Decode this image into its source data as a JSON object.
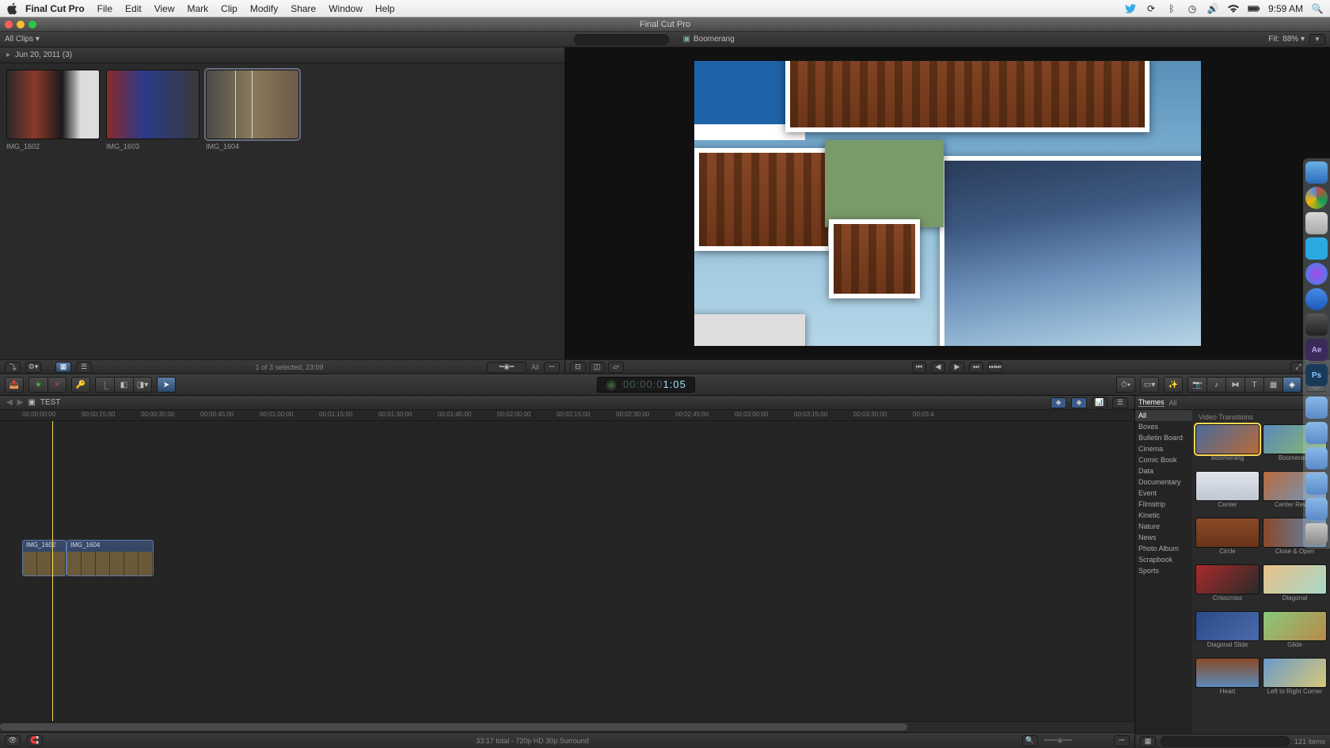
{
  "menubar": {
    "app_name": "Final Cut Pro",
    "menus": [
      "File",
      "Edit",
      "View",
      "Mark",
      "Clip",
      "Modify",
      "Share",
      "Window",
      "Help"
    ],
    "clock": "9:59 AM"
  },
  "window": {
    "title": "Final Cut Pro"
  },
  "browser": {
    "filter_label": "All Clips",
    "event_header": "Jun 20, 2011  (3)",
    "clips": [
      {
        "name": "IMG_1602"
      },
      {
        "name": "IMG_1603"
      },
      {
        "name": "IMG_1604"
      }
    ],
    "footer_status": "1 of 3 selected, 23:09",
    "footer_audio_label": "All"
  },
  "viewer": {
    "title": "Boomerang",
    "fit_label": "Fit:",
    "fit_value": "88%"
  },
  "toolbar": {
    "timecode_dim": "00:00:0",
    "timecode_val": "1:05"
  },
  "timeline": {
    "project_name": "TEST",
    "marks": [
      "00:00:00:00",
      "00:00:15:00",
      "00:00:30:00",
      "00:00:45:00",
      "00:01:00:00",
      "00:01:15:00",
      "00:01:30:00",
      "00:01:45:00",
      "00:02:00:00",
      "00:02:15:00",
      "00:02:30:00",
      "00:02:45:00",
      "00:03:00:00",
      "00:03:15:00",
      "00:03:30:00",
      "00:03:4"
    ],
    "clips": [
      {
        "name": "IMG_1602"
      },
      {
        "name": "IMG_1604"
      }
    ],
    "footer_status": "33:17 total - 720p HD 30p Surround"
  },
  "fx": {
    "sidebar_label": "Themes",
    "sidebar_sub": "All",
    "section_label": "Video Transitions",
    "categories": [
      "All",
      "Boxes",
      "Bulletin Board",
      "Cinema",
      "Comic Book",
      "Data",
      "Documentary",
      "Event",
      "Filmstrip",
      "Kinetic",
      "Nature",
      "News",
      "Photo Album",
      "Scrapbook",
      "Sports"
    ],
    "items": [
      {
        "name": "Boomerang",
        "c": "linear-gradient(135deg,#4a6a9a,#b86a3a)"
      },
      {
        "name": "Boomerang",
        "c": "linear-gradient(135deg,#5a8aba,#8aba6a)"
      },
      {
        "name": "Center",
        "c": "linear-gradient(#e0e4ea,#c0c8d4)"
      },
      {
        "name": "Center Reveal",
        "c": "linear-gradient(135deg,#b86a3a,#6a9aca)"
      },
      {
        "name": "Circle",
        "c": "linear-gradient(#8a4a28,#6a3418)"
      },
      {
        "name": "Close & Open",
        "c": "linear-gradient(90deg,#8a4a28,#5a8aba)"
      },
      {
        "name": "Crisscross",
        "c": "linear-gradient(135deg,#aa2a2a,#2a2a2a)"
      },
      {
        "name": "Diagonal",
        "c": "linear-gradient(135deg,#e8c088,#a8d8c8)"
      },
      {
        "name": "Diagonal Slide",
        "c": "linear-gradient(135deg,#2a4a8a,#4a6aaa)"
      },
      {
        "name": "Glide",
        "c": "linear-gradient(135deg,#8ac87a,#b88a4a)"
      },
      {
        "name": "Heart",
        "c": "linear-gradient(#8a4a28,#5a8aba)"
      },
      {
        "name": "Left to Right Corner",
        "c": "linear-gradient(135deg,#6a9aca,#d8c878)"
      }
    ],
    "footer_count": "121 items"
  }
}
